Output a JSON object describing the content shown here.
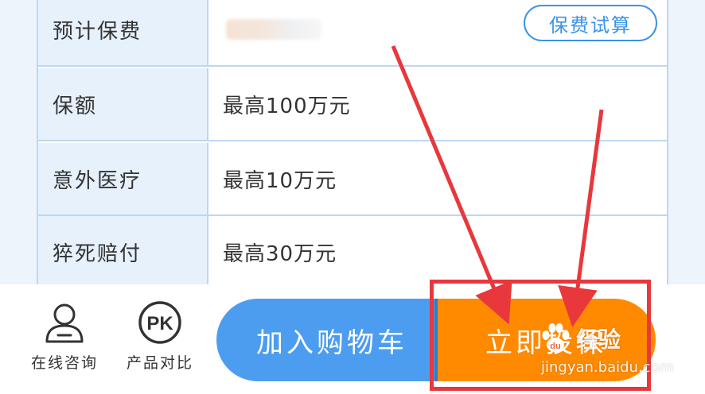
{
  "table": {
    "rows": [
      {
        "label": "预计保费",
        "value": ""
      },
      {
        "label": "保额",
        "value": "最高100万元"
      },
      {
        "label": "意外医疗",
        "value": "最高10万元"
      },
      {
        "label": "猝死赔付",
        "value": "最高30万元"
      }
    ],
    "calc_button": "保费试算"
  },
  "bottom_bar": {
    "consult_label": "在线咨询",
    "compare_label": "产品对比",
    "compare_icon_text": "PK",
    "add_to_cart": "加入购物车",
    "buy_now": "立即投保"
  },
  "watermark": {
    "brand": "经验",
    "url": "jingyan.baidu.com"
  },
  "colors": {
    "accent_blue": "#4c9df0",
    "accent_orange": "#ff8a00",
    "annotation_red": "#e8383c",
    "table_border": "#bcd7f3",
    "label_bg": "#e6f1fc"
  },
  "icons": [
    "user-consult-icon",
    "pk-compare-icon",
    "baidu-paw-icon"
  ]
}
